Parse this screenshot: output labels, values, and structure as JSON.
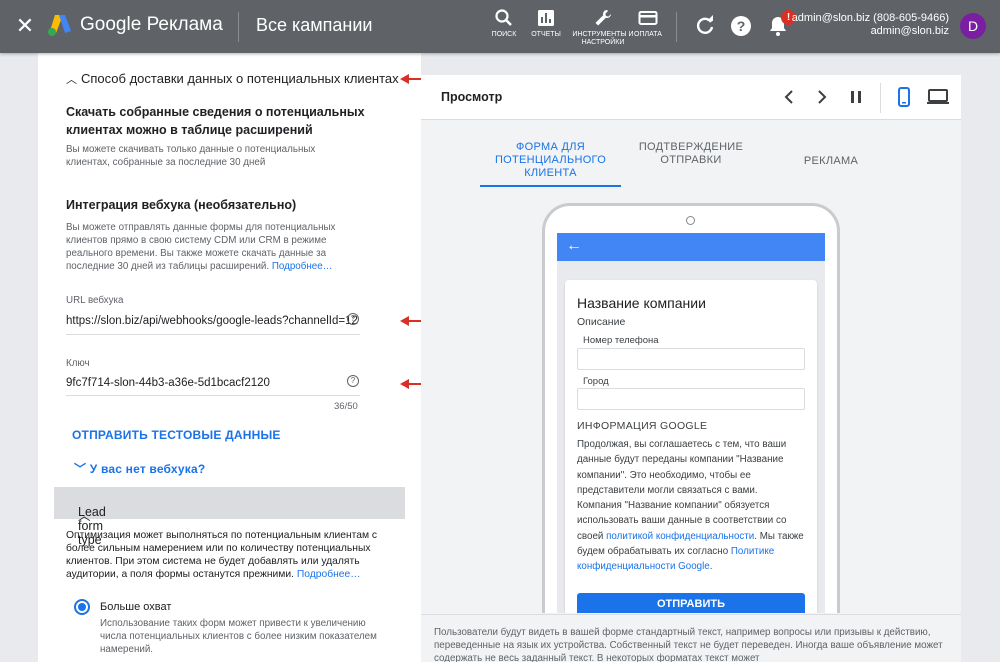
{
  "header": {
    "brand_google": "Google",
    "brand_product": "Реклама",
    "page_title": "Все кампании",
    "tools": [
      {
        "label": "ПОИСК",
        "icon": "search-icon"
      },
      {
        "label": "ОТЧЕТЫ",
        "icon": "reports-icon"
      },
      {
        "label": "ИНСТРУМЕНТЫ И НАСТРОЙКИ",
        "icon": "wrench-icon"
      },
      {
        "label": "ОПЛАТА",
        "icon": "billing-icon"
      }
    ],
    "notification_badge": "!",
    "account_line1": "admin@slon.biz (808-605-9466)",
    "account_line2": "admin@slon.biz",
    "avatar_letter": "D"
  },
  "left": {
    "delivery_heading": "Способ доставки данных о потенциальных клиентах",
    "download_title": "Скачать собранные сведения о потенциальных клиентах можно в таблице расширений",
    "download_note": "Вы можете скачивать только данные о потенциальных клиентах, собранные за последние 30 дней",
    "webhook_title": "Интеграция вебхука (необязательно)",
    "webhook_desc": "Вы можете отправлять данные формы для потенциальных клиентов прямо в свою систему CDM или CRM в режиме реального времени. Вы также можете скачать данные за последние 30 дней из таблицы расширений.",
    "webhook_learn_more": "Подробнее…",
    "url_label": "URL вебхука",
    "url_value": "https://slon.biz/api/webhooks/google-leads?channelId=12",
    "key_label": "Ключ",
    "key_value": "9fc7f714-slon-44b3-a36e-5d1bcacf2120",
    "key_counter": "36/50",
    "send_test": "ОТПРАВИТЬ ТЕСТОВЫЕ ДАННЫЕ",
    "no_webhook": "У вас нет вебхука?",
    "lead_form_type": "Lead form type",
    "optimization_desc": "Оптимизация может выполняться по потенциальным клиентам с более сильным намерением или по количеству потенциальных клиентов. При этом система не будет добавлять или удалять аудитории, а поля формы останутся прежними.",
    "optimization_learn_more": "Подробнее…",
    "radio_label": "Больше охват",
    "radio_desc": "Использование таких форм может привести к увеличению числа потенциальных клиентов с более низким показателем намерений."
  },
  "preview": {
    "title": "Просмотр",
    "tabs": [
      {
        "label": "ФОРМА ДЛЯ ПОТЕНЦИАЛЬНОГО КЛИЕНТА",
        "active": true
      },
      {
        "label": "ПОДТВЕРЖДЕНИЕ ОТПРАВКИ",
        "active": false
      },
      {
        "label": "РЕКЛАМА",
        "active": false
      }
    ],
    "form": {
      "company": "Название компании",
      "description": "Описание",
      "phone_label": "Номер телефона",
      "city_label": "Город",
      "google_info": "ИНФОРМАЦИЯ GOOGLE",
      "consent_1": "Продолжая, вы соглашаетесь с тем, что ваши данные будут переданы компании \"Название компании\". Это необходимо, чтобы ее представители могли связаться с вами. Компания \"Название компании\" обязуется использовать ваши данные в соответствии со своей ",
      "consent_link1": "политикой конфиденциальности",
      "consent_2": ". Мы также будем обрабатывать их согласно ",
      "consent_link2": "Политике конфиденциальности Google",
      "consent_3": ".",
      "submit": "ОТПРАВИТЬ"
    },
    "footer": "Пользователи будут видеть в вашей форме стандартный текст, например вопросы или призывы к действию, переведенные на язык их устройства. Собственный текст не будет переведен. Иногда ваше объявление может содержать не весь заданный текст. В некоторых форматах текст может"
  },
  "colors": {
    "accent": "#1a73e8",
    "topbar": "#5f6368",
    "arrow": "#d93025"
  }
}
